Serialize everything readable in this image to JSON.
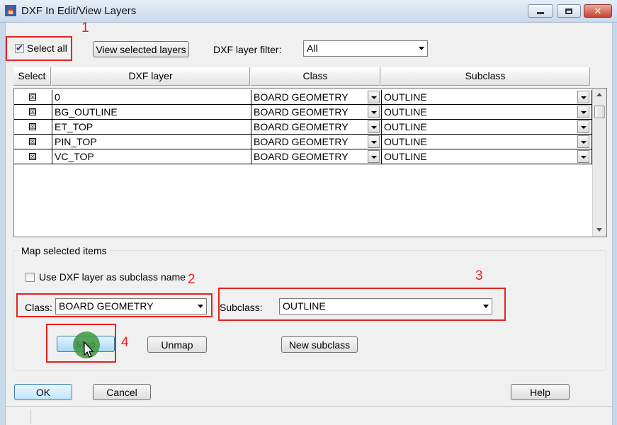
{
  "window": {
    "title": "DXF In Edit/View Layers"
  },
  "toolbar": {
    "select_all_label": "Select all",
    "select_all_checked": true,
    "view_selected_label": "View selected layers",
    "filter_label": "DXF layer filter:",
    "filter_value": "All"
  },
  "grid": {
    "headers": [
      "Select",
      "DXF layer",
      "Class",
      "Subclass"
    ],
    "rows": [
      {
        "selected": "☒",
        "layer": "0",
        "class": "BOARD GEOMETRY",
        "subclass": "OUTLINE"
      },
      {
        "selected": "☒",
        "layer": "BG_OUTLINE",
        "class": "BOARD GEOMETRY",
        "subclass": "OUTLINE"
      },
      {
        "selected": "☒",
        "layer": "ET_TOP",
        "class": "BOARD GEOMETRY",
        "subclass": "OUTLINE"
      },
      {
        "selected": "☒",
        "layer": "PIN_TOP",
        "class": "BOARD GEOMETRY",
        "subclass": "OUTLINE"
      },
      {
        "selected": "☒",
        "layer": "VC_TOP",
        "class": "BOARD GEOMETRY",
        "subclass": "OUTLINE"
      }
    ]
  },
  "map": {
    "group_title": "Map selected items",
    "use_layer_label": "Use DXF layer as subclass name",
    "class_label": "Class:",
    "class_value": "BOARD GEOMETRY",
    "subclass_label": "Subclass:",
    "subclass_value": "OUTLINE",
    "map_label": "Map",
    "unmap_label": "Unmap",
    "new_subclass_label": "New subclass"
  },
  "footer": {
    "ok_label": "OK",
    "cancel_label": "Cancel",
    "help_label": "Help"
  },
  "annotations": [
    "1",
    "2",
    "3",
    "4"
  ],
  "colors": {
    "annotation": "#e8221f",
    "click_indicator": "#3c963c"
  }
}
